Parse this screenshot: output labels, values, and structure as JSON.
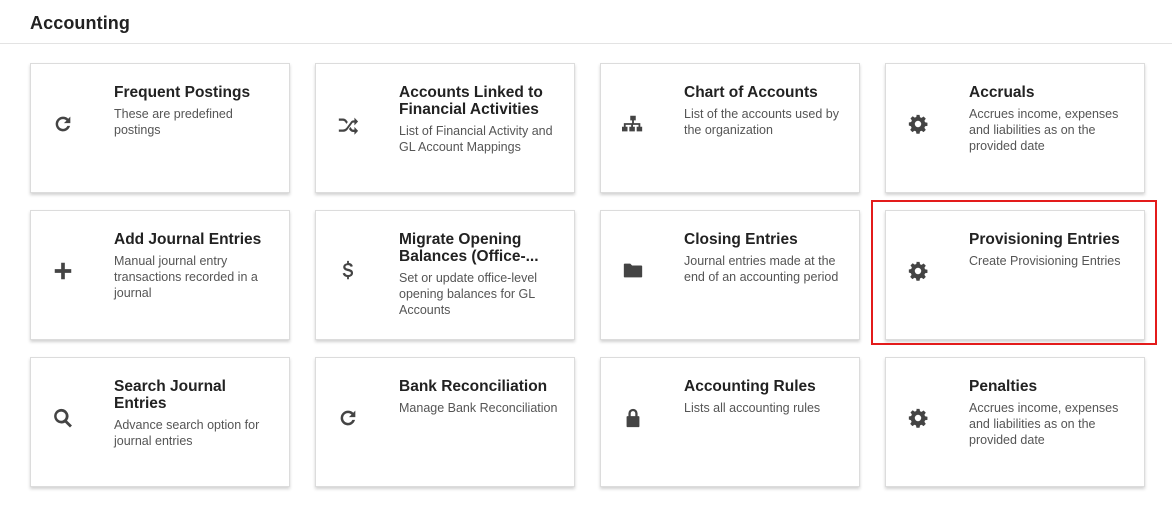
{
  "header": {
    "title": "Accounting"
  },
  "cards": [
    {
      "title": "Frequent Postings",
      "desc": "These are predefined postings",
      "icon": "refresh-icon"
    },
    {
      "title": "Accounts Linked to Financial Activities",
      "desc": "List of Financial Activity and GL Account Mappings",
      "icon": "shuffle-icon"
    },
    {
      "title": "Chart of Accounts",
      "desc": "List of the accounts used by the organization",
      "icon": "sitemap-icon"
    },
    {
      "title": "Accruals",
      "desc": "Accrues income, expenses and liabilities as on the provided date",
      "icon": "gear-icon"
    },
    {
      "title": "Add Journal Entries",
      "desc": "Manual journal entry transactions recorded in a journal",
      "icon": "plus-icon"
    },
    {
      "title": "Migrate Opening Balances (Office-...",
      "desc": "Set or update office-level opening balances for GL Accounts",
      "icon": "dollar-icon"
    },
    {
      "title": "Closing Entries",
      "desc": "Journal entries made at the end of an accounting period",
      "icon": "folder-icon"
    },
    {
      "title": "Provisioning Entries",
      "desc": "Create Provisioning Entries",
      "icon": "gear-icon"
    },
    {
      "title": "Search Journal Entries",
      "desc": "Advance search option for journal entries",
      "icon": "search-icon"
    },
    {
      "title": "Bank Reconciliation",
      "desc": "Manage Bank Reconciliation",
      "icon": "refresh-icon"
    },
    {
      "title": "Accounting Rules",
      "desc": "Lists all accounting rules",
      "icon": "lock-icon"
    },
    {
      "title": "Penalties",
      "desc": "Accrues income, expenses and liabilities as on the provided date",
      "icon": "gear-icon"
    }
  ],
  "highlight": {
    "target": "Provisioning Entries",
    "color": "#e31b1b"
  },
  "colors": {
    "icon": "#444444",
    "title": "#222222",
    "desc": "#555555"
  }
}
